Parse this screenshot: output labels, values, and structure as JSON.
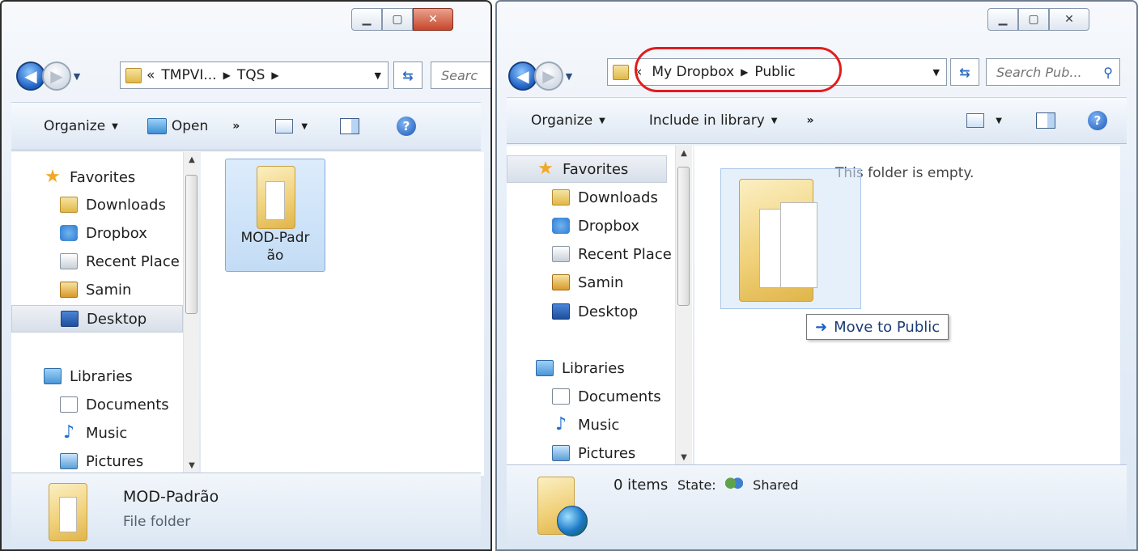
{
  "left_window": {
    "address": {
      "overflow": "«",
      "crumbs": [
        "TMPVI...",
        "TQS"
      ]
    },
    "search_placeholder": "Searc",
    "commands": {
      "organize": "Organize",
      "open": "Open",
      "more": "»"
    },
    "tree": {
      "favorites": "Favorites",
      "items": [
        "Downloads",
        "Dropbox",
        "Recent Place",
        "Samin",
        "Desktop"
      ],
      "libraries": "Libraries",
      "lib_items": [
        "Documents",
        "Music",
        "Pictures"
      ]
    },
    "content": {
      "tile_label_line1": "MOD-Padr",
      "tile_label_line2": "ão"
    },
    "details": {
      "name": "MOD-Padrão",
      "type": "File folder"
    }
  },
  "right_window": {
    "address": {
      "overflow": "«",
      "crumbs": [
        "My Dropbox",
        "Public"
      ]
    },
    "search_placeholder": "Search Pub...",
    "commands": {
      "organize": "Organize",
      "include_in_library": "Include in library",
      "more": "»"
    },
    "tree": {
      "favorites": "Favorites",
      "items": [
        "Downloads",
        "Dropbox",
        "Recent Place",
        "Samin",
        "Desktop"
      ],
      "libraries": "Libraries",
      "lib_items": [
        "Documents",
        "Music",
        "Pictures"
      ]
    },
    "content": {
      "empty_message": "This folder is empty.",
      "drag_tooltip": "Move to Public"
    },
    "details": {
      "count": "0 items",
      "state_label": "State:",
      "state_value": "Shared"
    }
  },
  "colors": {
    "highlight_ring": "#e01d1d",
    "close_button": "#c7462b",
    "selection": "#c3dcf5"
  }
}
